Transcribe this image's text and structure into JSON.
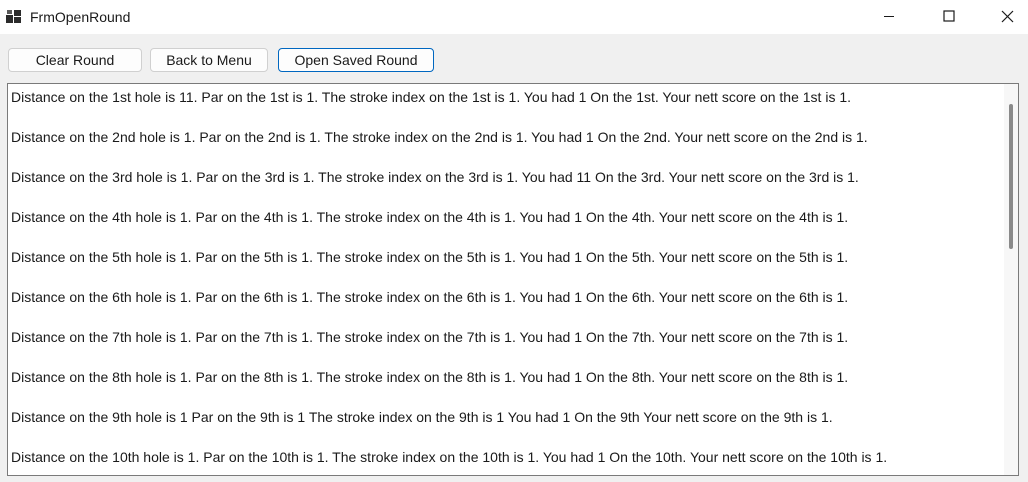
{
  "window": {
    "title": "FrmOpenRound"
  },
  "toolbar": {
    "clear_label": "Clear Round",
    "back_label": "Back to Menu",
    "open_label": "Open Saved Round"
  },
  "output": {
    "lines": [
      "Distance on the 1st hole is 11. Par on the 1st is 1. The stroke index on the 1st is 1. You had 1 On the 1st. Your nett score on the 1st is 1.",
      "Distance on the 2nd hole is 1. Par on the 2nd is 1. The stroke index on the 2nd is 1. You had 1 On the 2nd. Your nett score on the 2nd is 1.",
      "Distance on the 3rd hole is 1. Par on the 3rd is 1. The stroke index on the 3rd is 1. You had 11 On the 3rd. Your nett score on the 3rd is 1.",
      "Distance on the 4th hole is 1. Par on the 4th is 1. The stroke index on the 4th is 1. You had 1 On the 4th. Your nett score on the 4th is 1.",
      "Distance on the 5th hole is 1. Par on the 5th is 1. The stroke index on the 5th is 1. You had 1 On the 5th. Your nett score on the 5th is 1.",
      "Distance on the 6th hole is 1. Par on the 6th is 1. The stroke index on the 6th is 1. You had 1 On the 6th. Your nett score on the 6th is 1.",
      "Distance on the 7th hole is 1. Par on the 7th is 1. The stroke index on the 7th is 1. You had 1 On the 7th. Your nett score on the 7th is 1.",
      "Distance on the 8th hole is 1. Par on the 8th is 1. The stroke index on the 8th is 1. You had 1 On the 8th. Your nett score on the 8th is 1.",
      "Distance on the 9th hole is 1 Par on the 9th is 1 The stroke index on the 9th is 1 You had 1 On the 9th Your nett score on the 9th is 1.",
      "Distance on the 10th hole is 1. Par on the 10th is 1. The stroke index on the 10th is 1. You had 1 On the 10th. Your nett score on the 10th is 1."
    ]
  },
  "icons": {
    "app": "app-icon",
    "minimize": "minimize-icon",
    "maximize": "maximize-icon",
    "close": "close-icon"
  },
  "colors": {
    "accent": "#0067c0",
    "window_bg": "#f0f0f0"
  }
}
